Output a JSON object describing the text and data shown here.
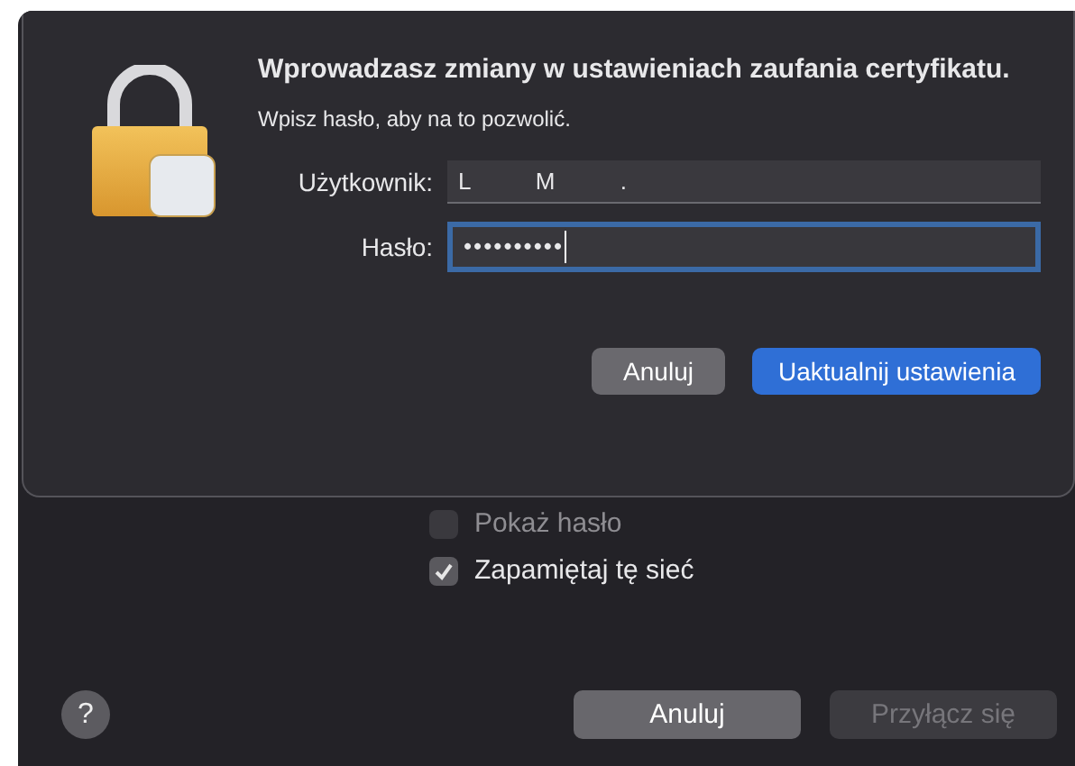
{
  "sheet": {
    "title": "Wprowadzasz zmiany w ustawieniach zaufania certyfikatu.",
    "subtitle": "Wpisz hasło, aby na to pozwolić.",
    "fields": [
      {
        "label": "Użytkownik:",
        "value": "L          M          .",
        "focused": false
      },
      {
        "label": "Hasło:",
        "value": "••••••••••",
        "focused": true
      }
    ],
    "buttons": [
      {
        "label": "Anuluj",
        "kind": "secondary"
      },
      {
        "label": "Uaktualnij ustawienia",
        "kind": "primary"
      }
    ]
  },
  "options": [
    {
      "label": "Pokaż hasło",
      "checked": false,
      "disabled": true
    },
    {
      "label": "Zapamiętaj tę sieć",
      "checked": true,
      "disabled": false
    }
  ],
  "help": "?",
  "buttons": [
    {
      "label": "Anuluj",
      "disabled": false
    },
    {
      "label": "Przyłącz się",
      "disabled": true
    }
  ]
}
